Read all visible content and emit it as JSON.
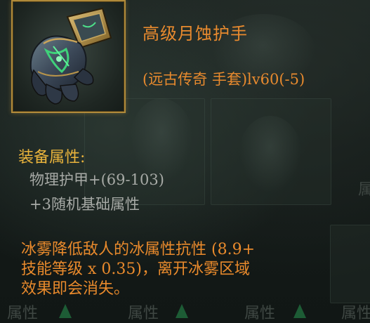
{
  "tooltip": {
    "item_name": "高级月蚀护手",
    "item_type": "(远古传奇 手套)lv60(-5)",
    "attributes_header": "装备属性:",
    "stats": [
      "物理护甲+(69-103)",
      "+3随机基础属性"
    ],
    "effect_lines": [
      "冰雾降低敌人的冰属性抗性 (8.9+",
      "技能等级 x 0.35)，离开冰雾区域",
      "效果即会消失。"
    ]
  },
  "icon": {
    "name": "gauntlet-icon",
    "frame_color": "#b08a3a"
  },
  "background": {
    "bottom_tabs": [
      "属性",
      "属性",
      "属性",
      "属性"
    ],
    "right_edge_text": "属"
  },
  "colors": {
    "legendary_orange": "#e88a2e",
    "header_gold": "#e9b33c",
    "stat_gray": "#a7aaa6"
  }
}
